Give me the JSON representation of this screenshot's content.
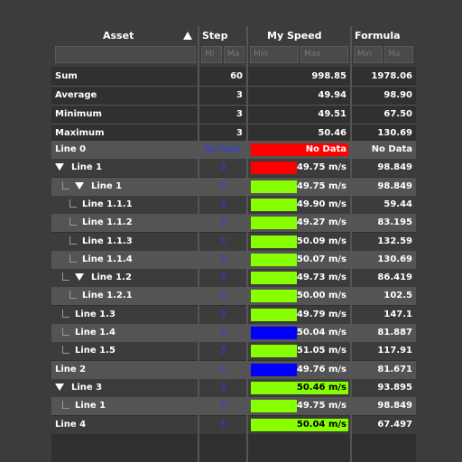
{
  "header": {
    "asset": "Asset",
    "step": "Step",
    "speed": "My Speed",
    "formula": "Formula",
    "step_min": "Mi",
    "step_max": "Ma",
    "speed_min": "Min",
    "speed_max": "Max",
    "formula_min": "Min",
    "formula_max": "Ma"
  },
  "summary": [
    {
      "label": "Sum",
      "step": "60",
      "speed": "998.85",
      "formula": "1978.06"
    },
    {
      "label": "Average",
      "step": "3",
      "speed": "49.94",
      "formula": "98.90"
    },
    {
      "label": "Minimum",
      "step": "3",
      "speed": "49.51",
      "formula": "67.50"
    },
    {
      "label": "Maximum",
      "step": "3",
      "speed": "50.46",
      "formula": "130.69"
    }
  ],
  "rows": [
    {
      "label": "Line 0",
      "step": "No Data",
      "speed": "No Data",
      "formula": "No Data",
      "depth": 0,
      "expander": false,
      "bar_color": "#ff0000",
      "bar_fill": 1.0,
      "bg": "#545454"
    },
    {
      "label": "Line 1",
      "step": "3",
      "speed": "49.75 m/s",
      "formula": "98.849",
      "depth": 0,
      "expander": true,
      "bar_color": "#ff0000",
      "bar_fill": 0.47,
      "bg": "#3c3c3c"
    },
    {
      "label": "Line 1",
      "step": "3",
      "speed": "49.75 m/s",
      "formula": "98.849",
      "depth": 1,
      "expander": true,
      "bar_color": "#88ff00",
      "bar_fill": 0.47,
      "bg": "#545454"
    },
    {
      "label": "Line 1.1.1",
      "step": "3",
      "speed": "49.90 m/s",
      "formula": "59.44",
      "depth": 2,
      "expander": false,
      "bar_color": "#88ff00",
      "bar_fill": 0.47,
      "bg": "#3c3c3c"
    },
    {
      "label": "Line 1.1.2",
      "step": "3",
      "speed": "49.27 m/s",
      "formula": "83.195",
      "depth": 2,
      "expander": false,
      "bar_color": "#88ff00",
      "bar_fill": 0.47,
      "bg": "#545454"
    },
    {
      "label": "Line 1.1.3",
      "step": "3",
      "speed": "50.09 m/s",
      "formula": "132.59",
      "depth": 2,
      "expander": false,
      "bar_color": "#88ff00",
      "bar_fill": 0.47,
      "bg": "#3c3c3c"
    },
    {
      "label": "Line 1.1.4",
      "step": "3",
      "speed": "50.07 m/s",
      "formula": "130.69",
      "depth": 2,
      "expander": false,
      "bar_color": "#88ff00",
      "bar_fill": 0.47,
      "bg": "#545454"
    },
    {
      "label": "Line 1.2",
      "step": "3",
      "speed": "49.73 m/s",
      "formula": "86.419",
      "depth": 1,
      "expander": true,
      "bar_color": "#88ff00",
      "bar_fill": 0.47,
      "bg": "#3c3c3c"
    },
    {
      "label": "Line 1.2.1",
      "step": "3",
      "speed": "50.00 m/s",
      "formula": "102.5",
      "depth": 2,
      "expander": false,
      "bar_color": "#88ff00",
      "bar_fill": 0.47,
      "bg": "#545454"
    },
    {
      "label": "Line 1.3",
      "step": "3",
      "speed": "49.79 m/s",
      "formula": "147.1",
      "depth": 1,
      "expander": false,
      "bar_color": "#88ff00",
      "bar_fill": 0.47,
      "bg": "#3c3c3c"
    },
    {
      "label": "Line 1.4",
      "step": "3",
      "speed": "50.04 m/s",
      "formula": "81.887",
      "depth": 1,
      "expander": false,
      "bar_color": "#0000ff",
      "bar_fill": 0.47,
      "bg": "#545454"
    },
    {
      "label": "Line 1.5",
      "step": "3",
      "speed": "51.05 m/s",
      "formula": "117.91",
      "depth": 1,
      "expander": false,
      "bar_color": "#88ff00",
      "bar_fill": 0.47,
      "bg": "#3c3c3c"
    },
    {
      "label": "Line 2",
      "step": "3",
      "speed": "49.76 m/s",
      "formula": "81.671",
      "depth": 0,
      "expander": false,
      "bar_color": "#0000ff",
      "bar_fill": 0.47,
      "bg": "#545454"
    },
    {
      "label": "Line 3",
      "step": "3",
      "speed": "50.46 m/s",
      "formula": "93.895",
      "depth": 0,
      "expander": true,
      "bar_color": "#88ff00",
      "bar_fill": 1.0,
      "bg": "#3c3c3c"
    },
    {
      "label": "Line 1",
      "step": "3",
      "speed": "49.75 m/s",
      "formula": "98.849",
      "depth": 1,
      "expander": false,
      "bar_color": "#88ff00",
      "bar_fill": 0.47,
      "bg": "#545454"
    },
    {
      "label": "Line 4",
      "step": "3",
      "speed": "50.04 m/s",
      "formula": "67.497",
      "depth": 0,
      "expander": false,
      "bar_color": "#88ff00",
      "bar_fill": 1.0,
      "bg": "#3c3c3c"
    }
  ]
}
